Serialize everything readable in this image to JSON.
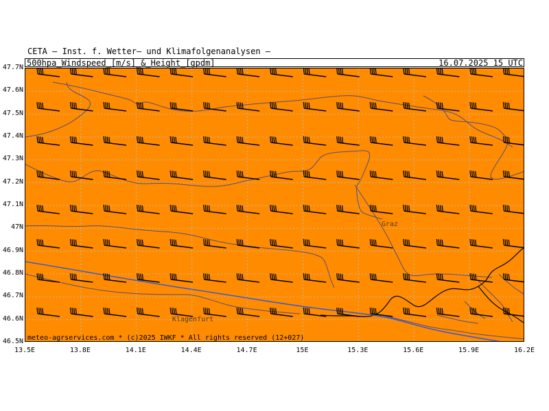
{
  "header": {
    "organization": "CETA – Inst. f. Wetter– und Klimafolgenanalysen –",
    "product": "500hpa_Windspeed_[m/s]_&_Height_[gpdm]",
    "valid_time": "16.07.2025 15 UTC"
  },
  "map": {
    "background_color": "#ff8c00",
    "grid_style": "dotted",
    "field_level": "all grid cells in single color band (orange)",
    "symbols": "wind barbs, westerly flow",
    "lon_labels": [
      "13.5E",
      "13.8E",
      "14.1E",
      "14.4E",
      "14.7E",
      "15E",
      "15.3E",
      "15.6E",
      "15.9E",
      "16.2E"
    ],
    "lat_labels": [
      "47.7N",
      "47.6N",
      "47.5N",
      "47.4N",
      "47.3N",
      "47.2N",
      "47.1N",
      "47N",
      "46.9N",
      "46.8N",
      "46.7N",
      "46.6N",
      "46.5N"
    ],
    "cities": {
      "graz": "Graz",
      "klagenfurt": "Klagenfurt"
    },
    "border_color": "#4a3a6a",
    "boundary_line_color": "#3a5ad0"
  },
  "footer": {
    "copyright": "meteo-agrservices.com * (c)2025 IWKF * All rights reserved (12+027)"
  }
}
